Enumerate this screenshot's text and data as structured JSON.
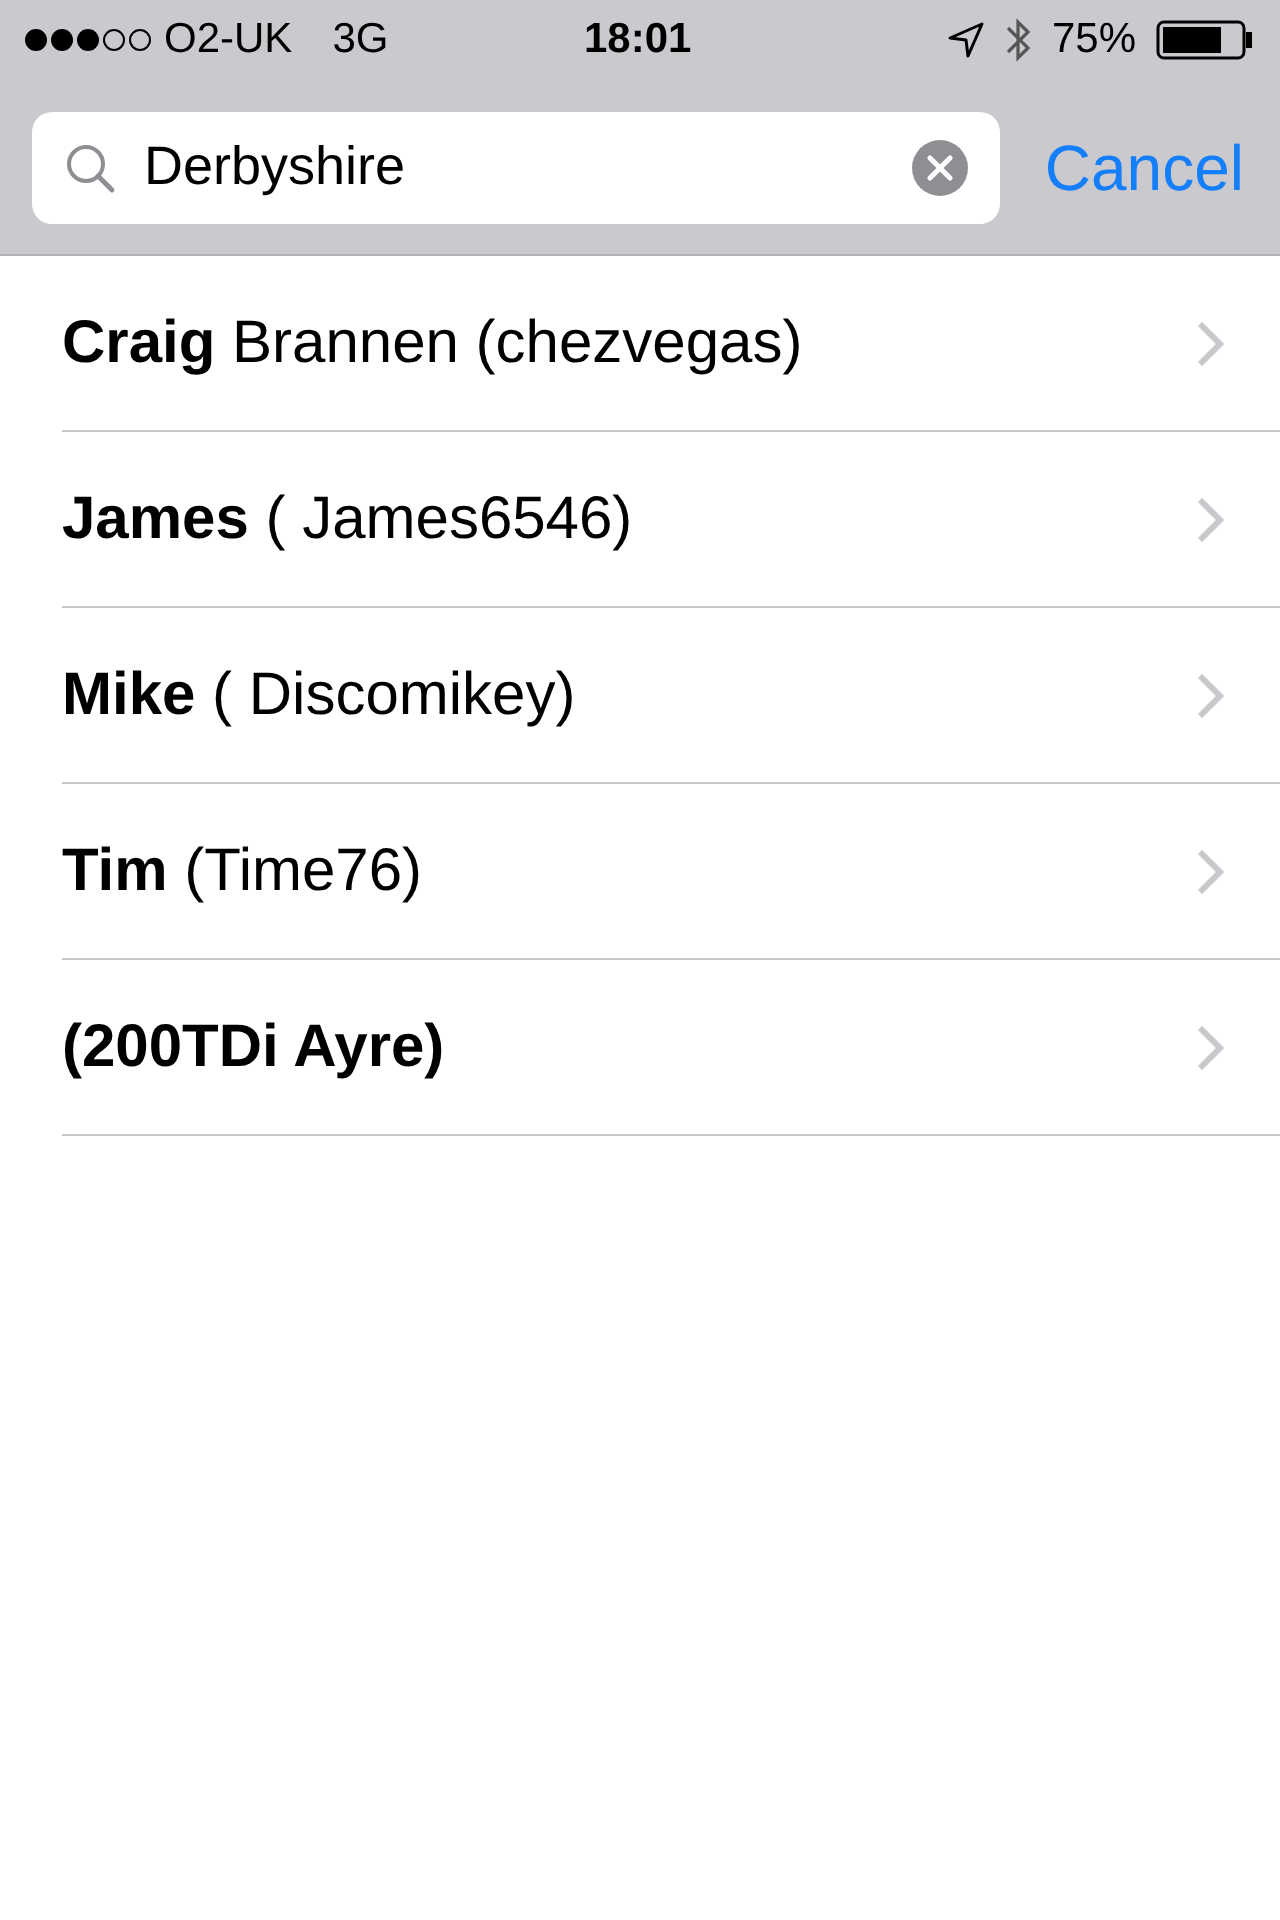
{
  "status_bar": {
    "carrier": "O2-UK",
    "network": "3G",
    "time": "18:01",
    "battery": "75%"
  },
  "search": {
    "value": "Derbyshire",
    "cancel": "Cancel"
  },
  "results": [
    {
      "bold": "Craig",
      "rest": "Brannen (chezvegas)"
    },
    {
      "bold": "James",
      "rest": "( James6546)"
    },
    {
      "bold": "Mike",
      "rest": "( Discomikey)"
    },
    {
      "bold": "Tim",
      "rest": "(Time76)"
    },
    {
      "bold": "(200TDi Ayre)"
    }
  ]
}
